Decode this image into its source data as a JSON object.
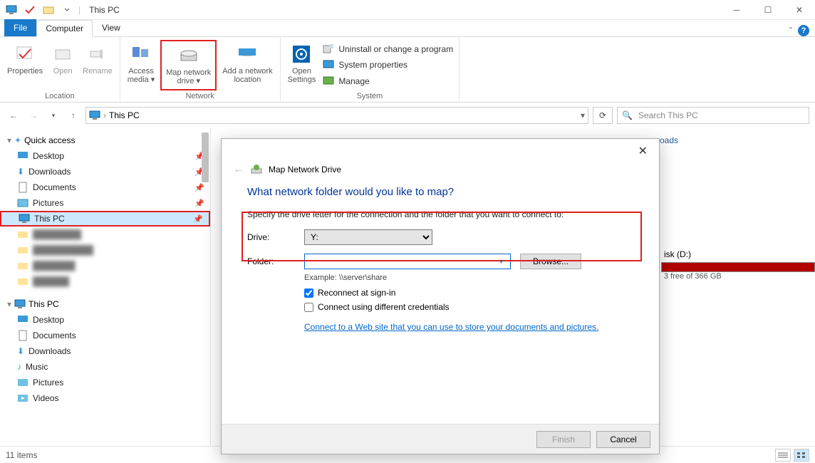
{
  "window": {
    "title": "This PC"
  },
  "tabs": {
    "file": "File",
    "computer": "Computer",
    "view": "View"
  },
  "ribbon": {
    "location": {
      "properties": "Properties",
      "open": "Open",
      "rename": "Rename",
      "label": "Location"
    },
    "network": {
      "access_media": "Access media",
      "map_drive": "Map network drive",
      "add_location": "Add a network location",
      "label": "Network"
    },
    "system": {
      "open_settings": "Open Settings",
      "uninstall": "Uninstall or change a program",
      "sys_props": "System properties",
      "manage": "Manage",
      "label": "System"
    }
  },
  "addressbar": {
    "location": "This PC",
    "search_placeholder": "Search This PC"
  },
  "nav": {
    "quick": "Quick access",
    "quick_items": [
      "Desktop",
      "Downloads",
      "Documents",
      "Pictures",
      "This PC"
    ],
    "thispc": "This PC",
    "thispc_items": [
      "Desktop",
      "Documents",
      "Downloads",
      "Music",
      "Pictures",
      "Videos"
    ]
  },
  "statusbar": {
    "count": "11 items"
  },
  "disk": {
    "name": "isk (D:)",
    "free": "3 free of 366 GB"
  },
  "dialog": {
    "title": "Map Network Drive",
    "heading": "What network folder would you like to map?",
    "desc": "Specify the drive letter for the connection and the folder that you want to connect to:",
    "drive_label": "Drive:",
    "drive_value": "Y:",
    "folder_label": "Folder:",
    "folder_value": "",
    "browse": "Browse...",
    "example": "Example: \\\\server\\share",
    "reconnect": "Reconnect at sign-in",
    "diff_creds": "Connect using different credentials",
    "link": "Connect to a Web site that you can use to store your documents and pictures",
    "finish": "Finish",
    "cancel": "Cancel"
  }
}
